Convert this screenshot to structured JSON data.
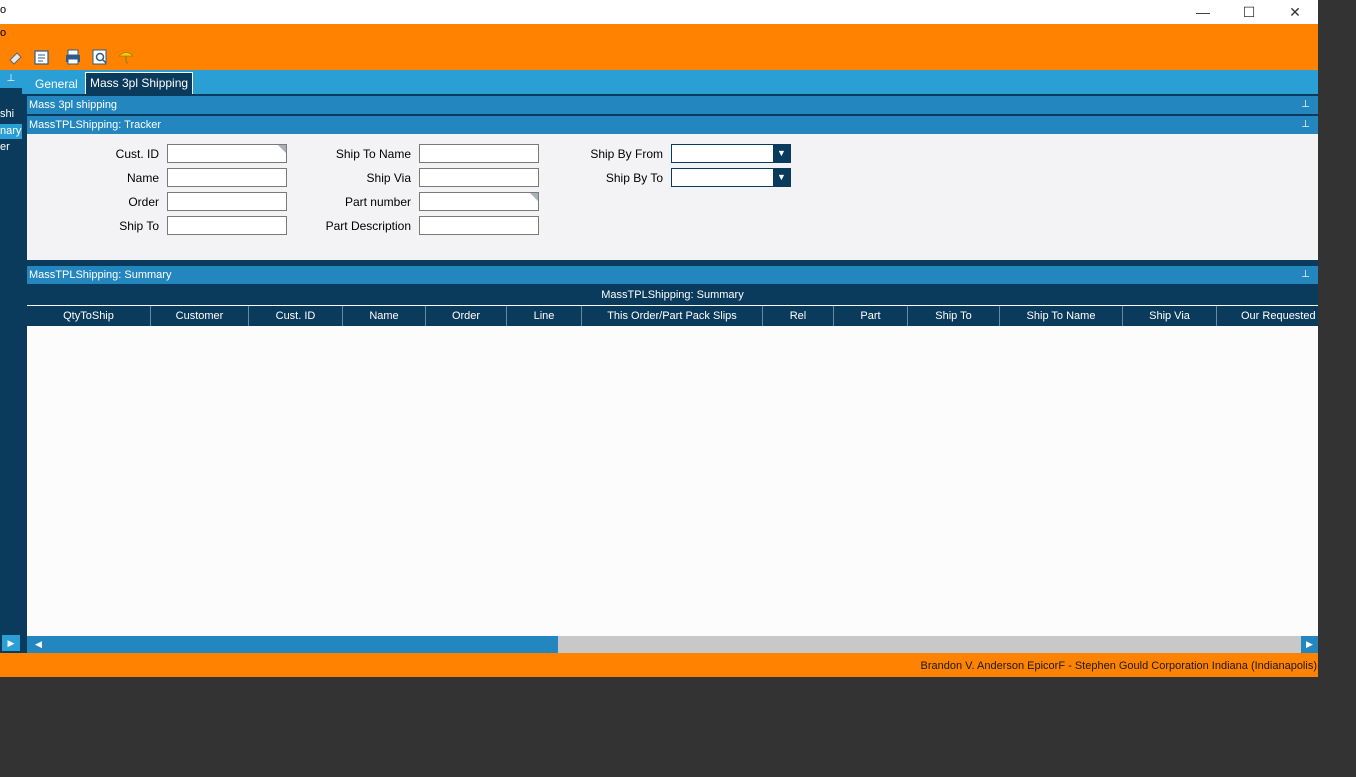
{
  "window": {
    "title_fragment": "o",
    "menu_fragment": "o",
    "controls": {
      "minimize": "—",
      "maximize": "☐",
      "close": "✕"
    }
  },
  "toolbar": {
    "icons": [
      "eraser-icon",
      "edit-icon",
      "print-icon",
      "print-preview-icon",
      "help-icon"
    ]
  },
  "leftnav": {
    "pin": "⊥",
    "items": [
      {
        "label": "shi",
        "selected": false
      },
      {
        "label": "nary",
        "selected": true
      },
      {
        "label": "er",
        "selected": false
      }
    ],
    "arrow": "▶"
  },
  "tabs": [
    {
      "label": "General",
      "active": false
    },
    {
      "label": "Mass 3pl Shipping",
      "active": true
    }
  ],
  "panels": {
    "outer": "Mass 3pl shipping",
    "tracker": "MassTPLShipping: Tracker",
    "summary": "MassTPLShipping: Summary",
    "pin": "⊥"
  },
  "tracker": {
    "fields": [
      {
        "label": "Cust. ID",
        "value": ""
      },
      {
        "label": "Name",
        "value": ""
      },
      {
        "label": "Order",
        "value": ""
      },
      {
        "label": "Ship To",
        "value": ""
      },
      {
        "label": "Ship To Name",
        "value": ""
      },
      {
        "label": "Ship Via",
        "value": ""
      },
      {
        "label": "Part number",
        "value": ""
      },
      {
        "label": "Part Description",
        "value": ""
      },
      {
        "label": "Ship By From",
        "value": ""
      },
      {
        "label": "Ship By To",
        "value": ""
      }
    ]
  },
  "grid": {
    "title": "MassTPLShipping: Summary",
    "columns": [
      "QtyToShip",
      "Customer",
      "Cust. ID",
      "Name",
      "Order",
      "Line",
      "This Order/Part Pack Slips",
      "Rel",
      "Part",
      "Ship To",
      "Ship To Name",
      "Ship Via",
      "Our Requested"
    ],
    "rows": []
  },
  "scroll": {
    "left": "◀",
    "right": "▶"
  },
  "status": {
    "text": "Brandon V. Anderson  EpicorF - Stephen Gould Corporation  Indiana (Indianapolis)"
  },
  "colors": {
    "accent": "#ff8200",
    "navy": "#0b3b5c",
    "blue": "#2a9fd6"
  }
}
